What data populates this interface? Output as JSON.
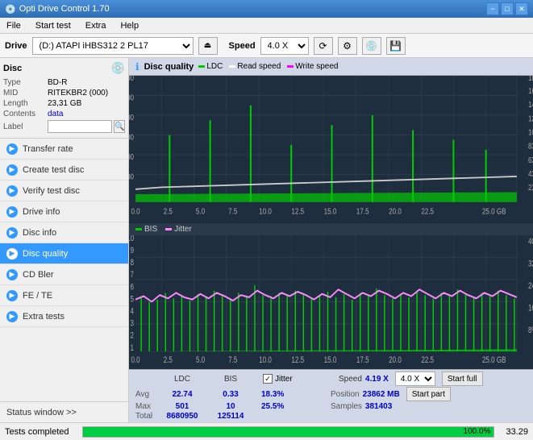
{
  "titlebar": {
    "title": "Opti Drive Control 1.70",
    "minimize": "−",
    "maximize": "□",
    "close": "✕"
  },
  "menubar": {
    "items": [
      "File",
      "Start test",
      "Extra",
      "Help"
    ]
  },
  "drivebar": {
    "label": "Drive",
    "drive_value": "(D:) ATAPI iHBS312  2 PL17",
    "speed_label": "Speed",
    "speed_value": "4.0 X"
  },
  "disc": {
    "title": "Disc",
    "type_label": "Type",
    "type_value": "BD-R",
    "mid_label": "MID",
    "mid_value": "RITEKBR2 (000)",
    "length_label": "Length",
    "length_value": "23,31 GB",
    "contents_label": "Contents",
    "contents_value": "data",
    "label_label": "Label"
  },
  "nav": {
    "items": [
      {
        "id": "transfer-rate",
        "label": "Transfer rate",
        "active": false
      },
      {
        "id": "create-test-disc",
        "label": "Create test disc",
        "active": false
      },
      {
        "id": "verify-test-disc",
        "label": "Verify test disc",
        "active": false
      },
      {
        "id": "drive-info",
        "label": "Drive info",
        "active": false
      },
      {
        "id": "disc-info",
        "label": "Disc info",
        "active": false
      },
      {
        "id": "disc-quality",
        "label": "Disc quality",
        "active": true
      },
      {
        "id": "cd-bler",
        "label": "CD Bler",
        "active": false
      },
      {
        "id": "fe-te",
        "label": "FE / TE",
        "active": false
      },
      {
        "id": "extra-tests",
        "label": "Extra tests",
        "active": false
      }
    ]
  },
  "status_window": "Status window >>",
  "quality": {
    "title": "Disc quality",
    "legend": {
      "ldc_label": "LDC",
      "ldc_color": "#00cc00",
      "read_label": "Read speed",
      "read_color": "#ffffff",
      "write_label": "Write speed",
      "write_color": "#ff00ff"
    },
    "legend2": {
      "bis_label": "BIS",
      "bis_color": "#00cc00",
      "jitter_label": "Jitter",
      "jitter_color": "#ff88ff"
    }
  },
  "stats": {
    "col_ldc": "LDC",
    "col_bis": "BIS",
    "col_jitter": "Jitter",
    "col_speed": "Speed",
    "avg_label": "Avg",
    "avg_ldc": "22.74",
    "avg_bis": "0.33",
    "avg_jitter": "18.3%",
    "max_label": "Max",
    "max_ldc": "501",
    "max_bis": "10",
    "max_jitter": "25.5%",
    "total_label": "Total",
    "total_ldc": "8680950",
    "total_bis": "125114",
    "speed_val": "4.19 X",
    "speed_label_static": "4.0 X",
    "position_label": "Position",
    "position_val": "23862 MB",
    "samples_label": "Samples",
    "samples_val": "381403",
    "start_full_label": "Start full",
    "start_part_label": "Start part"
  },
  "statusbar": {
    "text": "Tests completed",
    "progress": 100,
    "progress_label": "100.0%",
    "right_val": "33.29"
  }
}
